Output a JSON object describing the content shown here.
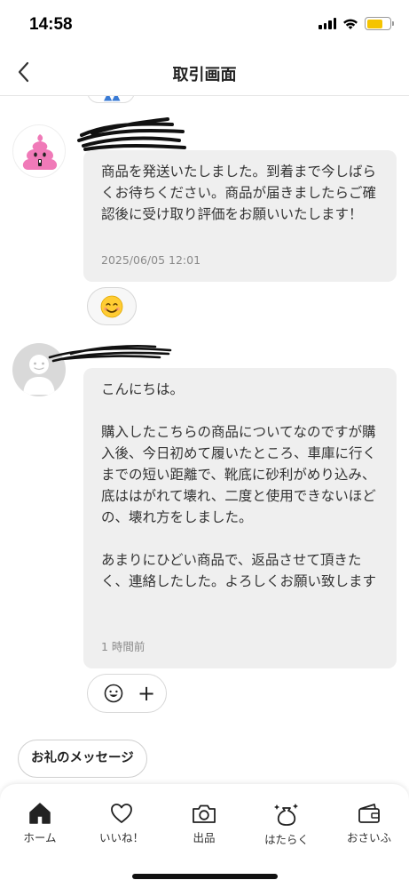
{
  "status_bar": {
    "time": "14:58"
  },
  "header": {
    "title": "取引画面"
  },
  "messages": [
    {
      "text": "商品を発送いたしました。到着まで今しばらくお待ちください。商品が届きましたらご確認後に受け取り評価をお願いいたします！",
      "timestamp": "2025/06/05 12:01",
      "reaction": "😊"
    },
    {
      "text": "こんにちは。\n\n購入したこちらの商品についてなのですが購入後、今日初めて履いたところ、車庫に行くまでの短い距離で、靴底に砂利がめり込み、底ははがれて壊れ、二度と使用できないほどの、壊れ方をしました。\n\nあまりにひどい商品で、返品させて頂きたく、連絡したした。よろしくお願い致します",
      "timestamp": "1 時間前"
    }
  ],
  "thanks_button": {
    "label": "お礼のメッセージ"
  },
  "tabbar": {
    "items": [
      {
        "label": "ホーム"
      },
      {
        "label": "いいね！"
      },
      {
        "label": "出品"
      },
      {
        "label": "はたらく"
      },
      {
        "label": "おさいふ"
      }
    ]
  },
  "colors": {
    "bubble": "#efefef",
    "battery": "#f5c400",
    "seller_avatar": "#f07ab8"
  }
}
